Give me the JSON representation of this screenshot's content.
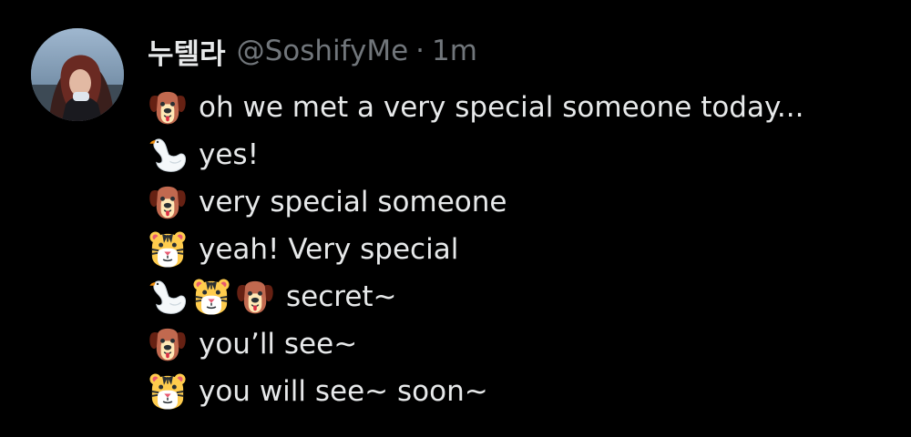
{
  "tweet": {
    "author": {
      "display_name": "누텔라",
      "handle": "@SoshifyMe",
      "separator": "·",
      "time": "1m"
    },
    "lines": [
      {
        "emojis": [
          "dog-face"
        ],
        "text": "oh we met a very special someone today..."
      },
      {
        "emojis": [
          "swan"
        ],
        "text": "yes!"
      },
      {
        "emojis": [
          "dog-face"
        ],
        "text": "very special someone"
      },
      {
        "emojis": [
          "tiger-face"
        ],
        "text": "yeah! Very special"
      },
      {
        "emojis": [
          "swan",
          "tiger-face",
          "dog-face"
        ],
        "text": "secret~"
      },
      {
        "emojis": [
          "dog-face"
        ],
        "text": "you’ll see~"
      },
      {
        "emojis": [
          "tiger-face"
        ],
        "text": "you will see~ soon~"
      }
    ]
  },
  "colors": {
    "background": "#000000",
    "primary_text": "#e7e9ea",
    "secondary_text": "#71767b"
  }
}
